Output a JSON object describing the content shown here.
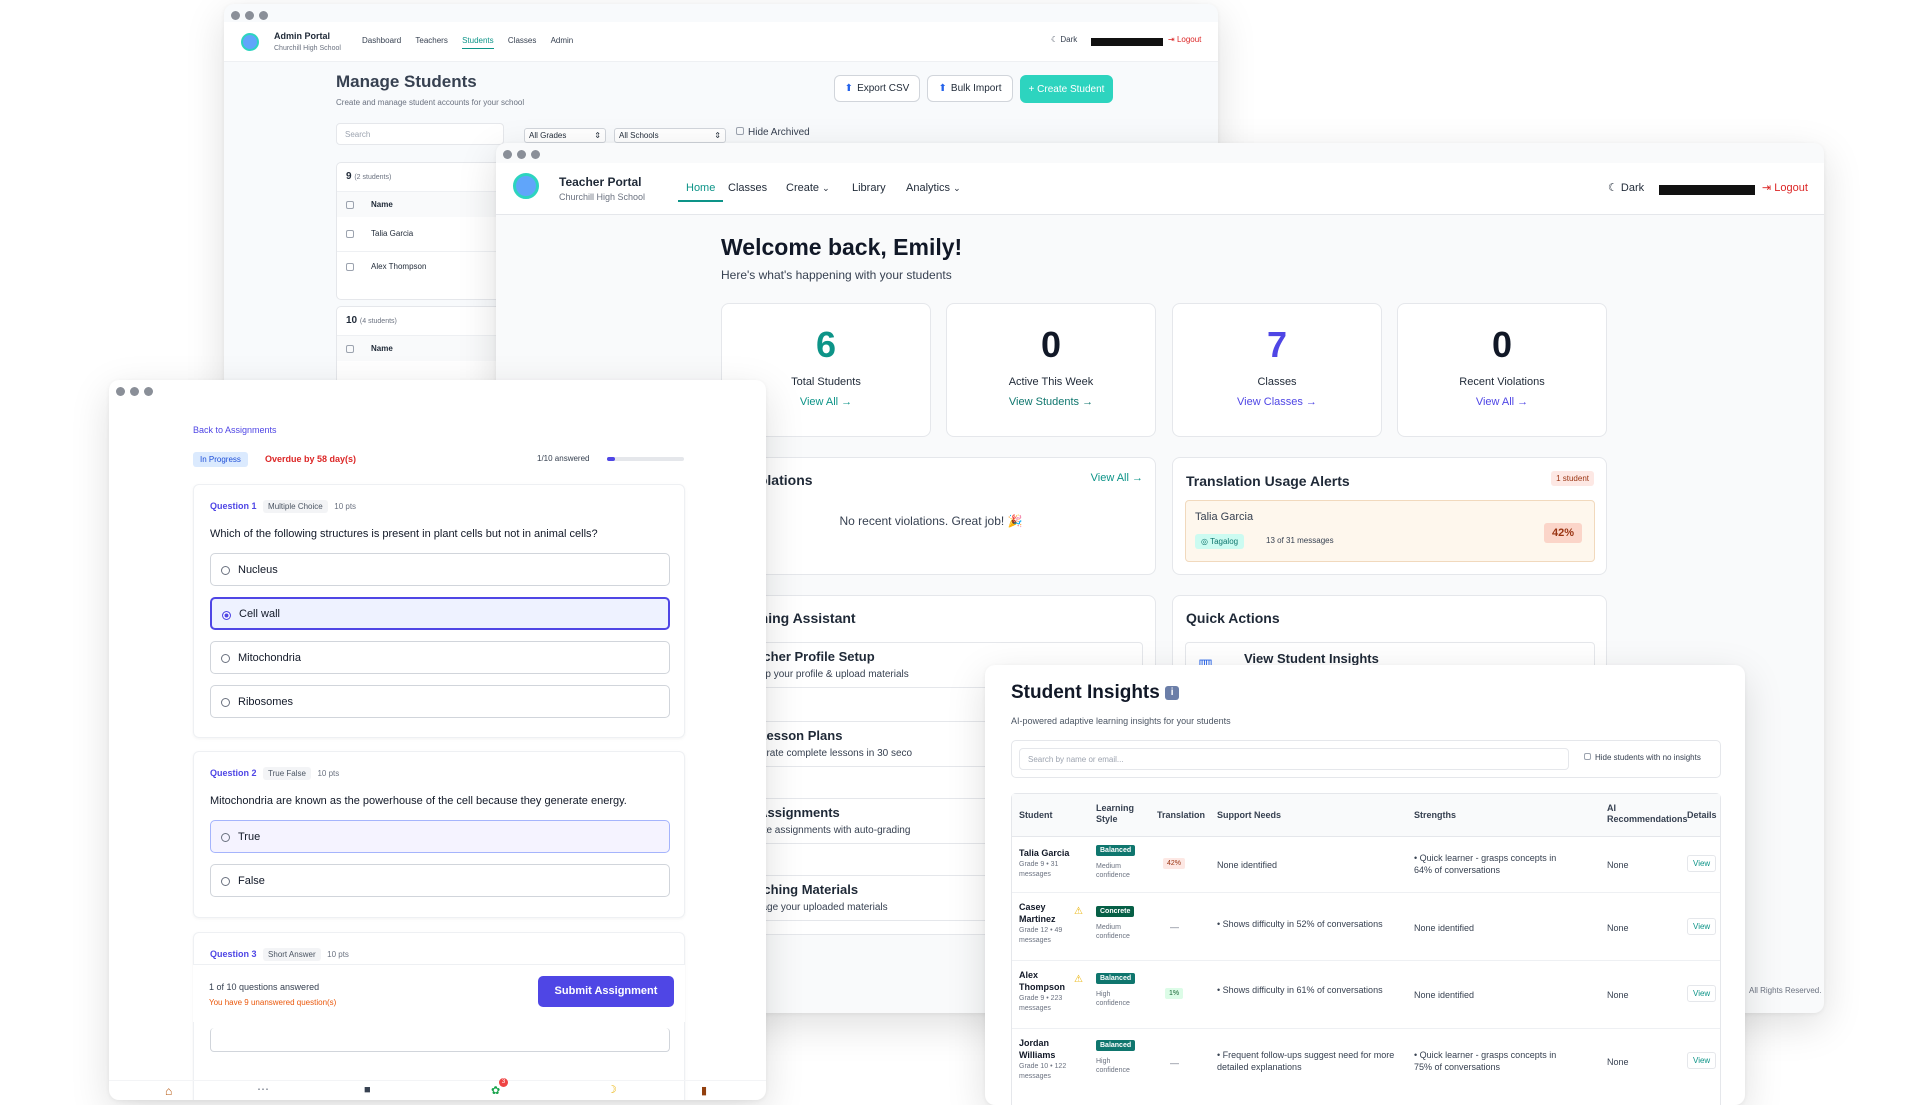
{
  "admin": {
    "portal_title": "Admin Portal",
    "school": "Churchill High School",
    "nav": [
      "Dashboard",
      "Teachers",
      "Students",
      "Classes",
      "Admin"
    ],
    "dark_label": "Dark",
    "logout_label": "Logout",
    "heading": "Manage Students",
    "subheading": "Create and manage student accounts for your school",
    "export_label": "Export CSV",
    "bulk_label": "Bulk Import",
    "create_label": "+ Create Student",
    "search_placeholder": "Search",
    "grade_filter": "All Grades",
    "school_filter": "All Schools",
    "hide_archived": "Hide Archived",
    "group1": {
      "grade": "9",
      "count": "(2 students)",
      "col": "Name",
      "students": [
        "Talia Garcia",
        "Alex Thompson"
      ]
    },
    "group2": {
      "grade": "10",
      "count": "(4 students)",
      "col": "Name"
    }
  },
  "teacher": {
    "portal_title": "Teacher Portal",
    "school": "Churchill High School",
    "nav": {
      "home": "Home",
      "classes": "Classes",
      "create": "Create",
      "library": "Library",
      "analytics": "Analytics"
    },
    "dark_label": "Dark",
    "logout_label": "Logout",
    "welcome": "Welcome back, Emily!",
    "welcome_sub": "Here's what's happening with your students",
    "stats": [
      {
        "value": "6",
        "label": "Total Students",
        "link": "View All →",
        "color": "#0d9488"
      },
      {
        "value": "0",
        "label": "Active This Week",
        "link": "View Students →",
        "color": "#111827"
      },
      {
        "value": "7",
        "label": "Classes",
        "link": "View Classes →",
        "color": "#4f46e5"
      },
      {
        "value": "0",
        "label": "Recent Violations",
        "link": "View All →",
        "color": "#111827"
      }
    ],
    "violations_title": "ent Violations",
    "violations_link": "View All →",
    "violations_empty": "No recent violations. Great job! 🎉",
    "translation_title": "Translation Usage Alerts",
    "translation_badge": "1 student",
    "translation_student": "Talia Garcia",
    "translation_lang": "Tagalog",
    "translation_msgs": "13 of 31 messages",
    "translation_pct": "42%",
    "assistant_title": "l Teaching Assistant",
    "assistant_items": [
      {
        "title": "Teacher Profile Setup",
        "desc": "Set up your profile & upload materials"
      },
      {
        "title": "AI Lesson Plans",
        "desc": "Generate complete lessons in 30 seco"
      },
      {
        "title": "AI Assignments",
        "desc": "Create assignments with auto-grading"
      },
      {
        "title": "Teaching Materials",
        "desc": "Manage your uploaded materials"
      }
    ],
    "quick_title": "Quick Actions",
    "quick_item": "View Student Insights",
    "footer": "All Rights Reserved."
  },
  "student": {
    "back": "Back to Assignments",
    "status": "In Progress",
    "overdue": "Overdue by 58 day(s)",
    "answered": "1/10 answered",
    "progress": 0.1,
    "q1": {
      "label": "Question 1",
      "type": "Multiple Choice",
      "pts": "10 pts",
      "text": "Which of the following structures is present in plant cells but not in animal cells?",
      "options": [
        "Nucleus",
        "Cell wall",
        "Mitochondria",
        "Ribosomes"
      ]
    },
    "q2": {
      "label": "Question 2",
      "type": "True False",
      "pts": "10 pts",
      "text": "Mitochondria are known as the powerhouse of the cell because they generate energy.",
      "options": [
        "True",
        "False"
      ]
    },
    "q3": {
      "label": "Question 3",
      "type": "Short Answer",
      "pts": "10 pts"
    },
    "summary": "1 of 10 questions answered",
    "unanswered": "You have 9 unanswered question(s)",
    "submit": "Submit Assignment",
    "badge_count": "3"
  },
  "insights": {
    "title": "Student Insights",
    "subtitle": "AI-powered adaptive learning insights for your students",
    "search_placeholder": "Search by name or email...",
    "hide_label": "Hide students with no insights",
    "headers": {
      "student": "Student",
      "style": "Learning Style",
      "translation": "Translation",
      "support": "Support Needs",
      "strengths": "Strengths",
      "ai": "AI Recommendations",
      "details": "Details"
    },
    "rows": [
      {
        "name": "Talia Garcia",
        "meta": "Grade 9 • 31 messages",
        "style": "Balanced",
        "conf": "Medium confidence",
        "trans": "42%",
        "support": "None identified",
        "strengths": "• Quick learner - grasps concepts in 64% of conversations",
        "ai": "None",
        "view": "View"
      },
      {
        "name": "Casey Martinez",
        "meta": "Grade 12 • 49 messages",
        "style": "Concrete",
        "conf": "Medium confidence",
        "trans": "—",
        "support": "• Shows difficulty in 52% of conversations",
        "strengths": "None identified",
        "ai": "None",
        "view": "View"
      },
      {
        "name": "Alex Thompson",
        "meta": "Grade 9 • 223 messages",
        "style": "Balanced",
        "conf": "High confidence",
        "trans": "1%",
        "support": "• Shows difficulty in 61% of conversations",
        "strengths": "None identified",
        "ai": "None",
        "view": "View"
      },
      {
        "name": "Jordan Williams",
        "meta": "Grade 10 • 122 messages",
        "style": "Balanced",
        "conf": "High confidence",
        "trans": "—",
        "support": "• Frequent follow-ups suggest need for more detailed explanations",
        "strengths": "• Quick learner - grasps concepts in 75% of conversations",
        "ai": "None",
        "view": "View"
      }
    ]
  }
}
